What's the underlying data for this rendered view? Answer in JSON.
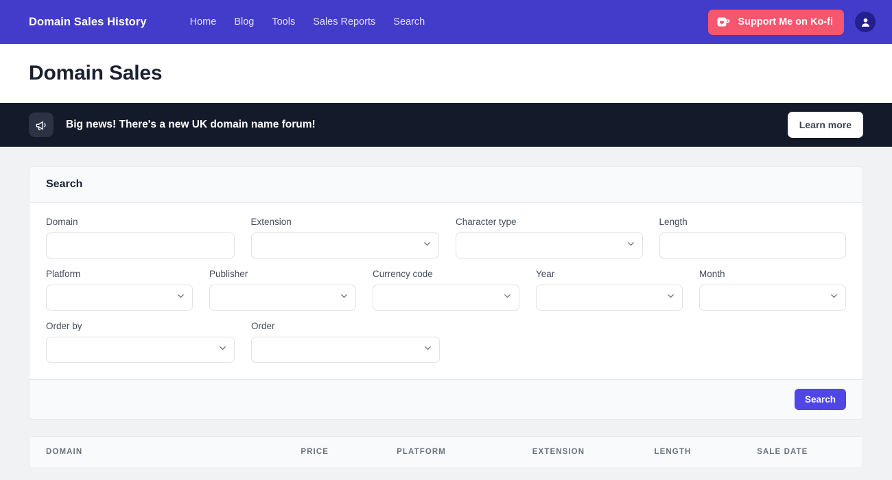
{
  "navbar": {
    "brand": "Domain Sales History",
    "links": [
      {
        "label": "Home"
      },
      {
        "label": "Blog"
      },
      {
        "label": "Tools"
      },
      {
        "label": "Sales Reports"
      },
      {
        "label": "Search"
      }
    ],
    "kofi_label": "Support Me on Ko-fi",
    "kofi_color": "#f7566f",
    "bg_color": "#433bc9",
    "avatar_icon": "user-icon"
  },
  "header": {
    "page_title": "Domain Sales"
  },
  "banner": {
    "icon": "megaphone-icon",
    "message": "Big news! There's a new UK domain name forum!",
    "button_label": "Learn more",
    "bg_color": "#131a29"
  },
  "search_card": {
    "title": "Search",
    "rows": [
      [
        {
          "label": "Domain",
          "type": "text",
          "value": "",
          "placeholder": ""
        },
        {
          "label": "Extension",
          "type": "select",
          "value": ""
        },
        {
          "label": "Character type",
          "type": "select",
          "value": ""
        },
        {
          "label": "Length",
          "type": "text",
          "value": "",
          "placeholder": ""
        }
      ],
      [
        {
          "label": "Platform",
          "type": "select",
          "value": ""
        },
        {
          "label": "Publisher",
          "type": "select",
          "value": ""
        },
        {
          "label": "Currency code",
          "type": "select",
          "value": ""
        },
        {
          "label": "Year",
          "type": "select",
          "value": ""
        },
        {
          "label": "Month",
          "type": "select",
          "value": ""
        }
      ],
      [
        {
          "label": "Order by",
          "type": "select",
          "value": ""
        },
        {
          "label": "Order",
          "type": "select",
          "value": ""
        }
      ]
    ],
    "submit_label": "Search",
    "submit_color": "#4f46e5"
  },
  "results_table": {
    "columns": [
      "DOMAIN",
      "PRICE",
      "PLATFORM",
      "EXTENSION",
      "LENGTH",
      "SALE DATE"
    ],
    "rows": []
  }
}
